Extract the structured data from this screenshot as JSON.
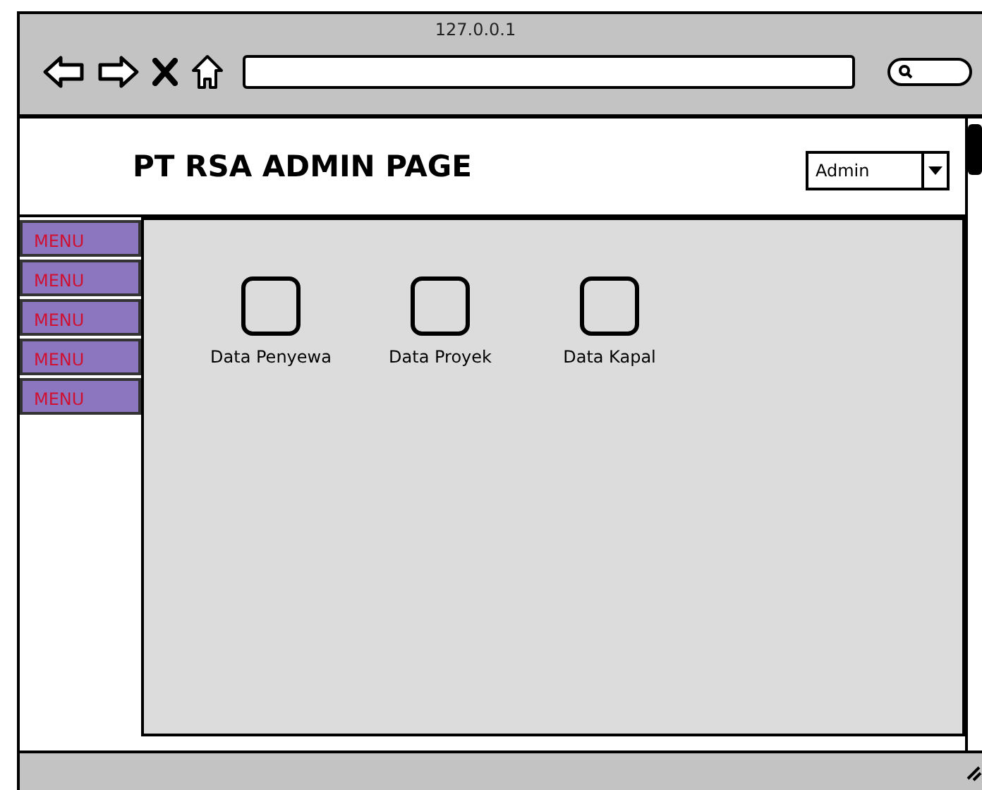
{
  "browser": {
    "address_title": "127.0.0.1"
  },
  "header": {
    "title": "PT RSA ADMIN PAGE",
    "user_dropdown": {
      "value": "Admin"
    }
  },
  "sidebar": {
    "items": [
      {
        "label": "MENU"
      },
      {
        "label": "MENU"
      },
      {
        "label": "MENU"
      },
      {
        "label": "MENU"
      },
      {
        "label": "MENU"
      }
    ]
  },
  "shortcuts": [
    {
      "label": "Data Penyewa"
    },
    {
      "label": "Data Proyek"
    },
    {
      "label": "Data Kapal"
    }
  ]
}
